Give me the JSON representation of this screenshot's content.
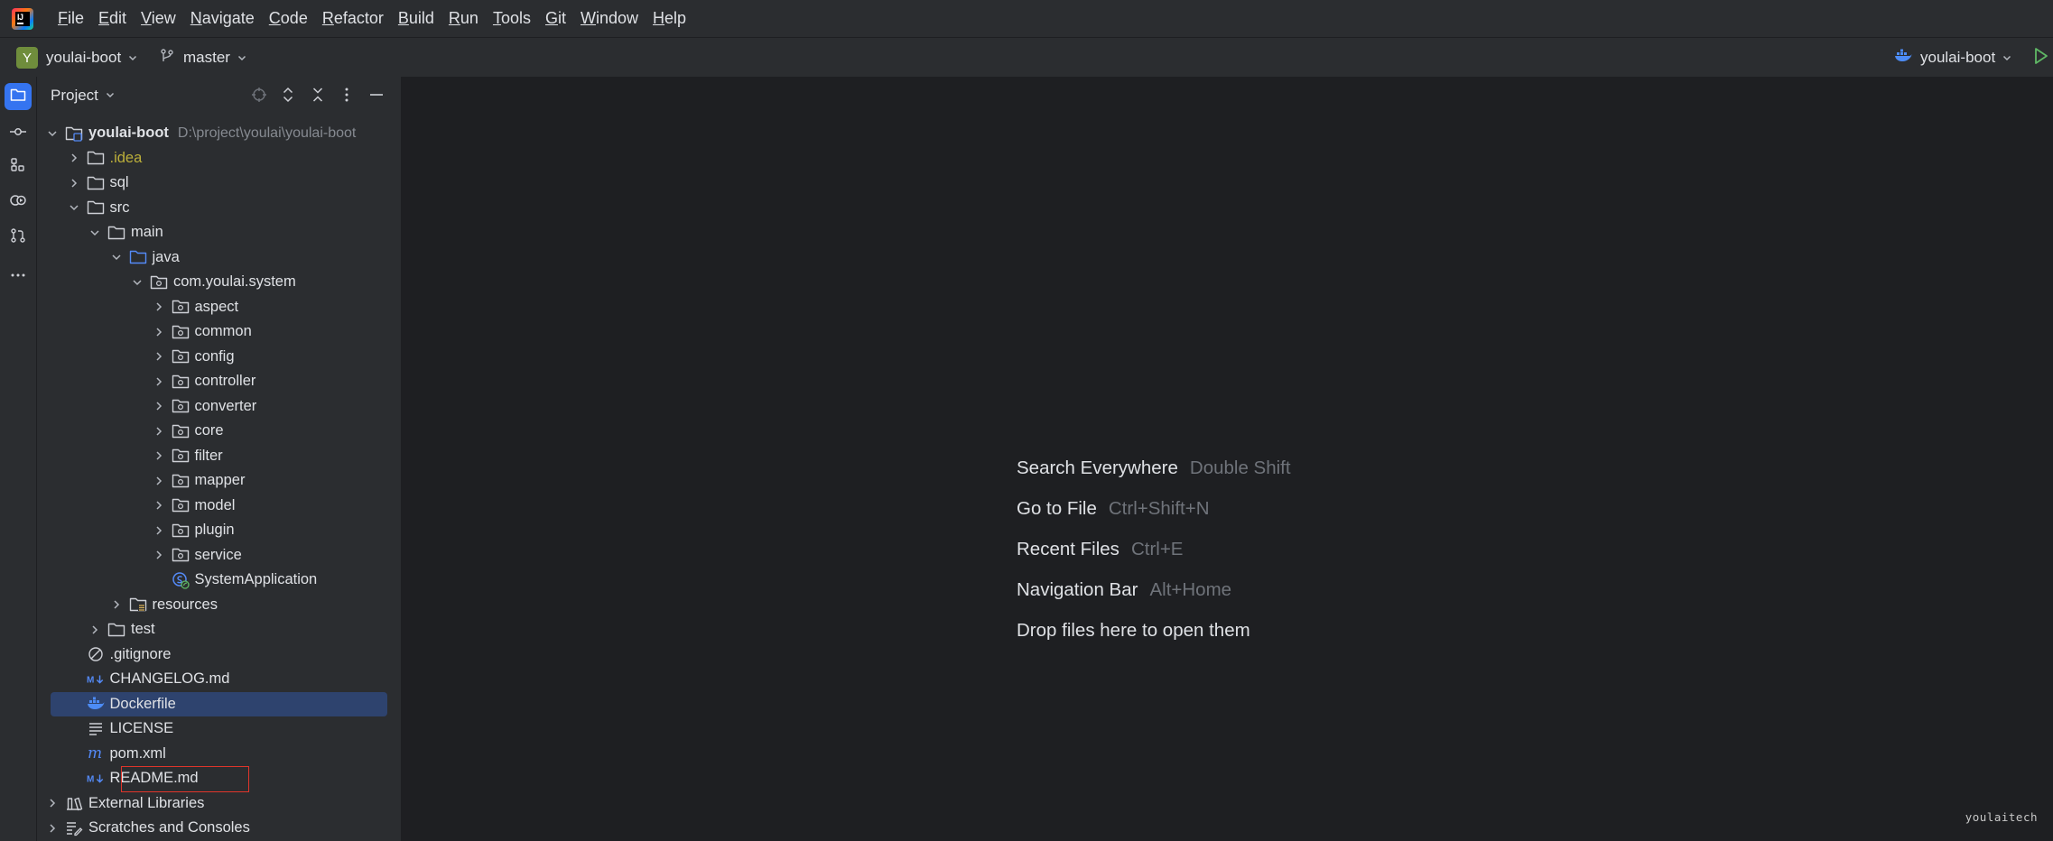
{
  "menubar": {
    "items": [
      {
        "mnemonic": "F",
        "rest": "ile"
      },
      {
        "mnemonic": "E",
        "rest": "dit"
      },
      {
        "mnemonic": "V",
        "rest": "iew"
      },
      {
        "mnemonic": "N",
        "rest": "avigate"
      },
      {
        "mnemonic": "C",
        "rest": "ode"
      },
      {
        "mnemonic": "R",
        "rest": "efactor"
      },
      {
        "mnemonic": "B",
        "rest": "uild"
      },
      {
        "mnemonic": "R",
        "rest": "un"
      },
      {
        "mnemonic": "T",
        "rest": "ools"
      },
      {
        "mnemonic": "G",
        "rest": "it"
      },
      {
        "mnemonic": "W",
        "rest": "indow"
      },
      {
        "mnemonic": "H",
        "rest": "elp"
      }
    ]
  },
  "toolbar": {
    "project_badge": "Y",
    "project_name": "youlai-boot",
    "branch": "master",
    "run_config": "youlai-boot"
  },
  "stripe": {
    "icons": [
      "project-icon",
      "commit-icon",
      "structure-icon",
      "services-icon",
      "pull-requests-icon",
      "more-icon"
    ]
  },
  "project_panel": {
    "title": "Project",
    "header_icons": [
      "locate-icon",
      "expand-all-icon",
      "collapse-all-icon",
      "options-icon",
      "hide-icon"
    ],
    "tree": [
      {
        "label": "youlai-boot",
        "path": "D:\\project\\youlai\\youlai-boot",
        "icon": "module-folder",
        "state": "open",
        "depth": 0,
        "bold": true
      },
      {
        "label": ".idea",
        "icon": "folder",
        "state": "closed",
        "depth": 1,
        "excluded": true
      },
      {
        "label": "sql",
        "icon": "folder",
        "state": "closed",
        "depth": 1
      },
      {
        "label": "src",
        "icon": "folder",
        "state": "open",
        "depth": 1
      },
      {
        "label": "main",
        "icon": "folder",
        "state": "open",
        "depth": 2
      },
      {
        "label": "java",
        "icon": "source-folder",
        "state": "open",
        "depth": 3
      },
      {
        "label": "com.youlai.system",
        "icon": "package",
        "state": "open",
        "depth": 4
      },
      {
        "label": "aspect",
        "icon": "package",
        "state": "closed",
        "depth": 5
      },
      {
        "label": "common",
        "icon": "package",
        "state": "closed",
        "depth": 5
      },
      {
        "label": "config",
        "icon": "package",
        "state": "closed",
        "depth": 5
      },
      {
        "label": "controller",
        "icon": "package",
        "state": "closed",
        "depth": 5
      },
      {
        "label": "converter",
        "icon": "package",
        "state": "closed",
        "depth": 5
      },
      {
        "label": "core",
        "icon": "package",
        "state": "closed",
        "depth": 5
      },
      {
        "label": "filter",
        "icon": "package",
        "state": "closed",
        "depth": 5
      },
      {
        "label": "mapper",
        "icon": "package",
        "state": "closed",
        "depth": 5
      },
      {
        "label": "model",
        "icon": "package",
        "state": "closed",
        "depth": 5
      },
      {
        "label": "plugin",
        "icon": "package",
        "state": "closed",
        "depth": 5
      },
      {
        "label": "service",
        "icon": "package",
        "state": "closed",
        "depth": 5
      },
      {
        "label": "SystemApplication",
        "icon": "spring-class",
        "state": "none",
        "depth": 5
      },
      {
        "label": "resources",
        "icon": "resources-folder",
        "state": "closed",
        "depth": 3
      },
      {
        "label": "test",
        "icon": "folder",
        "state": "closed",
        "depth": 2
      },
      {
        "label": ".gitignore",
        "icon": "ignore-file",
        "state": "none",
        "depth": 1
      },
      {
        "label": "CHANGELOG.md",
        "icon": "markdown-file",
        "state": "none",
        "depth": 1
      },
      {
        "label": "Dockerfile",
        "icon": "docker-file",
        "state": "none",
        "depth": 1,
        "selected": true
      },
      {
        "label": "LICENSE",
        "icon": "text-file",
        "state": "none",
        "depth": 1
      },
      {
        "label": "pom.xml",
        "icon": "maven-file",
        "state": "none",
        "depth": 1
      },
      {
        "label": "README.md",
        "icon": "markdown-file",
        "state": "none",
        "depth": 1
      },
      {
        "label": "External Libraries",
        "icon": "libraries",
        "state": "closed",
        "depth": 0
      },
      {
        "label": "Scratches and Consoles",
        "icon": "scratches",
        "state": "closed",
        "depth": 0
      }
    ]
  },
  "editor": {
    "hints": [
      {
        "action": "Search Everywhere",
        "shortcut": "Double Shift"
      },
      {
        "action": "Go to File",
        "shortcut": "Ctrl+Shift+N"
      },
      {
        "action": "Recent Files",
        "shortcut": "Ctrl+E"
      },
      {
        "action": "Navigation Bar",
        "shortcut": "Alt+Home"
      },
      {
        "action": "Drop files here to open them",
        "shortcut": ""
      }
    ],
    "watermark": "youlaitech"
  },
  "colors": {
    "accent": "#3574f0",
    "selection": "#2e436e",
    "highlight_box": "#e0352b",
    "excluded_text": "#bbae3a",
    "editor_bg": "#1e1f22",
    "panel_bg": "#2b2d30"
  }
}
